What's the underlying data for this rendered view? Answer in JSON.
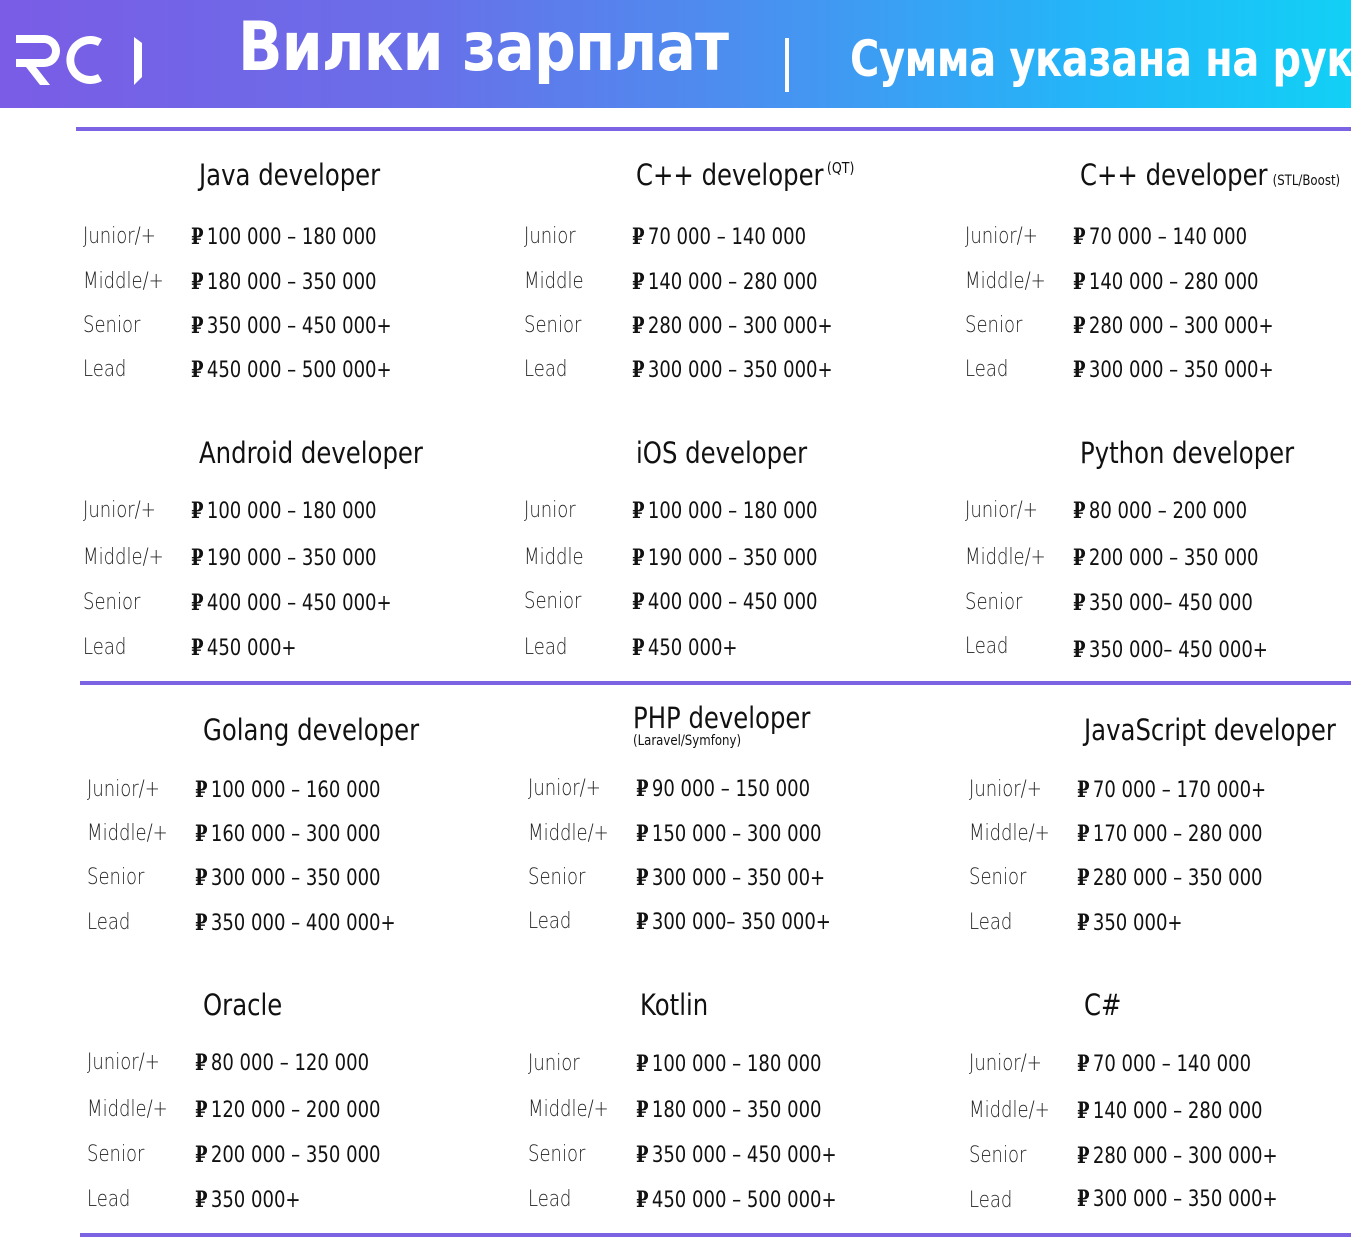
{
  "header": {
    "logo_text": "RCI",
    "title": "Вилки зарплат",
    "separator": "|",
    "subtitle": "Сумма указана на руки",
    "gradient_start": "#7a5ce6",
    "gradient_end": "#12d0f6"
  },
  "accent_color": "#7b63e3",
  "currency_symbol": "₽",
  "blocks": [
    {
      "title": "Java developer",
      "note": "",
      "rows": [
        {
          "level": "Junior/+",
          "range": "100 000 – 180 000"
        },
        {
          "level": "Middle/+",
          "range": "180 000 – 350 000"
        },
        {
          "level": "Senior",
          "range": "350 000 – 450 000+"
        },
        {
          "level": "Lead",
          "range": "450 000 – 500 000+"
        }
      ]
    },
    {
      "title": "C++ developer",
      "note": "(QT)",
      "rows": [
        {
          "level": "Junior",
          "range": "70 000 – 140 000"
        },
        {
          "level": "Middle",
          "range": "140 000 – 280 000"
        },
        {
          "level": "Senior",
          "range": "280 000 – 300 000+"
        },
        {
          "level": "Lead",
          "range": "300 000 – 350 000+"
        }
      ]
    },
    {
      "title": "C++ developer",
      "note": "(STL/Boost)",
      "rows": [
        {
          "level": "Junior/+",
          "range": "70 000 – 140 000"
        },
        {
          "level": "Middle/+",
          "range": "140 000 – 280 000"
        },
        {
          "level": "Senior",
          "range": "280 000 – 300 000+"
        },
        {
          "level": "Lead",
          "range": "300 000 – 350 000+"
        }
      ]
    },
    {
      "title": "Android developer",
      "note": "",
      "rows": [
        {
          "level": "Junior/+",
          "range": "100 000 – 180 000"
        },
        {
          "level": "Middle/+",
          "range": "190 000 – 350 000"
        },
        {
          "level": "Senior",
          "range": "400 000 – 450 000+"
        },
        {
          "level": "Lead",
          "range": "450 000+"
        }
      ]
    },
    {
      "title": "iOS developer",
      "note": "",
      "rows": [
        {
          "level": "Junior",
          "range": "100 000 – 180 000"
        },
        {
          "level": "Middle",
          "range": "190 000 – 350 000"
        },
        {
          "level": "Senior",
          "range": "400 000 – 450 000"
        },
        {
          "level": "Lead",
          "range": "450 000+"
        }
      ]
    },
    {
      "title": "Python developer",
      "note": "",
      "rows": [
        {
          "level": "Junior/+",
          "range": "80 000 – 200 000"
        },
        {
          "level": "Middle/+",
          "range": "200 000 – 350 000"
        },
        {
          "level": "Senior",
          "range": "350 000– 450 000"
        },
        {
          "level": "Lead",
          "range": "350 000– 450 000+"
        }
      ]
    },
    {
      "title": "Golang developer",
      "note": "",
      "rows": [
        {
          "level": "Junior/+",
          "range": "100 000 – 160 000"
        },
        {
          "level": "Middle/+",
          "range": "160 000 – 300 000"
        },
        {
          "level": "Senior",
          "range": "300 000 – 350 000"
        },
        {
          "level": "Lead",
          "range": "350 000 – 400 000+"
        }
      ]
    },
    {
      "title": "PHP developer",
      "note": "(Laravel/Symfony)",
      "rows": [
        {
          "level": "Junior/+",
          "range": "90 000 – 150 000"
        },
        {
          "level": "Middle/+",
          "range": "150 000 – 300 000"
        },
        {
          "level": "Senior",
          "range": "300 000 – 350 00+"
        },
        {
          "level": "Lead",
          "range": "300 000– 350 000+"
        }
      ]
    },
    {
      "title": "JavaScript developer",
      "note": "",
      "rows": [
        {
          "level": "Junior/+",
          "range": "70 000 – 170 000+"
        },
        {
          "level": "Middle/+",
          "range": "170 000 – 280 000"
        },
        {
          "level": "Senior",
          "range": "280 000 – 350 000"
        },
        {
          "level": "Lead",
          "range": "350 000+"
        }
      ]
    },
    {
      "title": "Oracle",
      "note": "",
      "rows": [
        {
          "level": "Junior/+",
          "range": "80 000 – 120 000"
        },
        {
          "level": "Middle/+",
          "range": "120 000 – 200 000"
        },
        {
          "level": "Senior",
          "range": "200 000 – 350 000"
        },
        {
          "level": "Lead",
          "range": "350 000+"
        }
      ]
    },
    {
      "title": "Kotlin",
      "note": "",
      "rows": [
        {
          "level": "Junior",
          "range": "100 000 – 180 000"
        },
        {
          "level": "Middle/+",
          "range": "180 000 – 350 000"
        },
        {
          "level": "Senior",
          "range": "350 000 – 450 000+"
        },
        {
          "level": "Lead",
          "range": "450 000 – 500 000+"
        }
      ]
    },
    {
      "title": "C#",
      "note": "",
      "rows": [
        {
          "level": "Junior/+",
          "range": "70 000 – 140 000"
        },
        {
          "level": "Middle/+",
          "range": "140 000 – 280 000"
        },
        {
          "level": "Senior",
          "range": "280 000 – 300 000+"
        },
        {
          "level": "Lead",
          "range": "300 000 – 350 000+"
        }
      ]
    }
  ]
}
